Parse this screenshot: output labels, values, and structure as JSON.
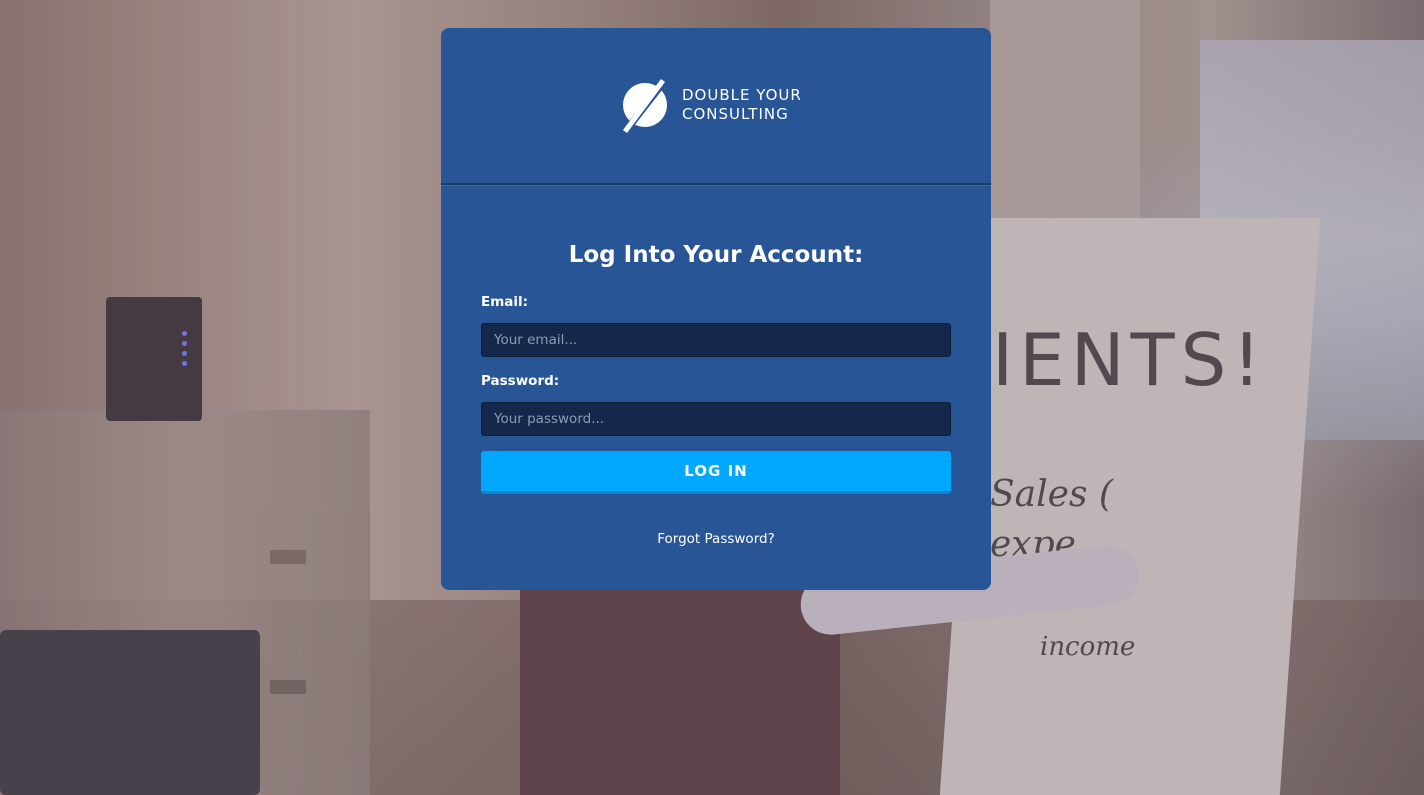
{
  "logo": {
    "line1": "DOUBLE YOUR",
    "line2": "CONSULTING"
  },
  "form": {
    "title": "Log Into Your Account:",
    "email_label": "Email:",
    "email_placeholder": "Your email...",
    "email_value": "",
    "password_label": "Password:",
    "password_placeholder": "Your password...",
    "password_value": "",
    "login_label": "LOG IN",
    "forgot_label": "Forgot Password?"
  },
  "background": {
    "board_line1": "IENTS!",
    "board_line2": "Sales (",
    "board_line3": "expe",
    "board_line4": "income"
  },
  "colors": {
    "card": "#285596",
    "input_bg": "#14284b",
    "button": "#00a8ff",
    "text": "#ffffff"
  }
}
